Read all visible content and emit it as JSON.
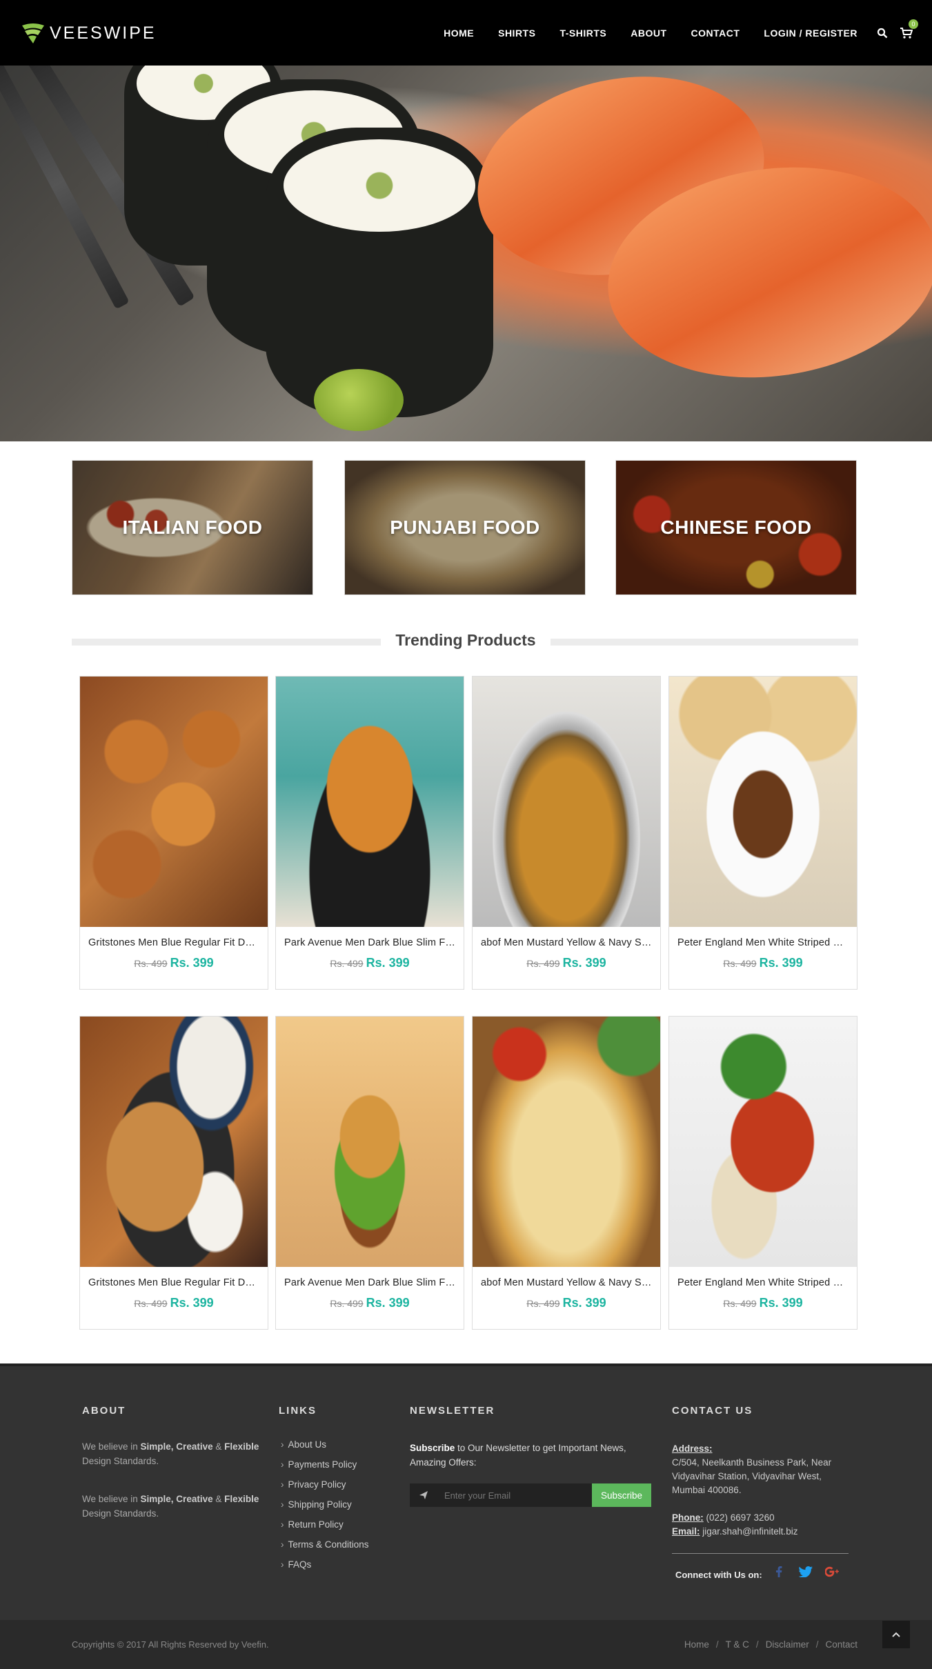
{
  "brand": {
    "name": "VEESWIPE"
  },
  "nav": {
    "items": [
      "HOME",
      "SHIRTS",
      "T-SHIRTS",
      "ABOUT",
      "CONTACT",
      "LOGIN / REGISTER"
    ],
    "cart_count": "0"
  },
  "categories": [
    "ITALIAN FOOD",
    "PUNJABI FOOD",
    "CHINESE FOOD"
  ],
  "trending": {
    "title": "Trending Products"
  },
  "products": [
    {
      "name": "Gritstones Men Blue Regular Fit Denim Shirt",
      "old_price": "Rs. 499",
      "price": "Rs. 399"
    },
    {
      "name": "Park Avenue Men Dark Blue Slim Fit Shirt",
      "old_price": "Rs. 499",
      "price": "Rs. 399"
    },
    {
      "name": "abof Men Mustard Yellow & Navy Shirt",
      "old_price": "Rs. 499",
      "price": "Rs. 399"
    },
    {
      "name": "Peter England Men White Striped Shirt",
      "old_price": "Rs. 499",
      "price": "Rs. 399"
    },
    {
      "name": "Gritstones Men Blue Regular Fit Denim Shirt",
      "old_price": "Rs. 499",
      "price": "Rs. 399"
    },
    {
      "name": "Park Avenue Men Dark Blue Slim Fit Shirt",
      "old_price": "Rs. 499",
      "price": "Rs. 399"
    },
    {
      "name": "abof Men Mustard Yellow & Navy Shirt",
      "old_price": "Rs. 499",
      "price": "Rs. 399"
    },
    {
      "name": "Peter England Men White Striped Shirt",
      "old_price": "Rs. 499",
      "price": "Rs. 399"
    }
  ],
  "footer": {
    "about": {
      "heading": "ABOUT",
      "p1_pre": "We believe in ",
      "p1_b1": "Simple, Creative",
      "p1_amp": " & ",
      "p1_b2": "Flexible",
      "p1_post": " Design Standards.",
      "p2_pre": "We believe in ",
      "p2_b1": "Simple, Creative",
      "p2_amp": " & ",
      "p2_b2": "Flexible",
      "p2_post": " Design Standards."
    },
    "links": {
      "heading": "LINKS",
      "items": [
        "About Us",
        "Payments Policy",
        "Privacy Policy",
        "Shipping Policy",
        "Return Policy",
        "Terms & Conditions",
        "FAQs"
      ]
    },
    "newsletter": {
      "heading": "NEWSLETTER",
      "text_bold": "Subscribe",
      "text_rest": " to Our Newsletter to get Important News, Amazing Offers:",
      "placeholder": "Enter your Email",
      "button": "Subscribe"
    },
    "contact": {
      "heading": "CONTACT US",
      "address_label": "Address:",
      "address": "C/504, Neelkanth Business Park, Near Vidyavihar Station, Vidyavihar West, Mumbai 400086.",
      "phone_label": "Phone:",
      "phone": " (022) 6697 3260",
      "email_label": "Email:",
      "email": " jigar.shah@infinitelt.biz",
      "connect": "Connect with Us on:"
    },
    "copyright": "Copyrights © 2017 All Rights Reserved by Veefin.",
    "bottom_links": [
      "Home",
      "T & C",
      "Disclaimer",
      "Contact"
    ]
  },
  "colors": {
    "accent_price": "#1cb4a0",
    "subscribe_green": "#5cb85c",
    "logo_green": "#8bc34a"
  }
}
